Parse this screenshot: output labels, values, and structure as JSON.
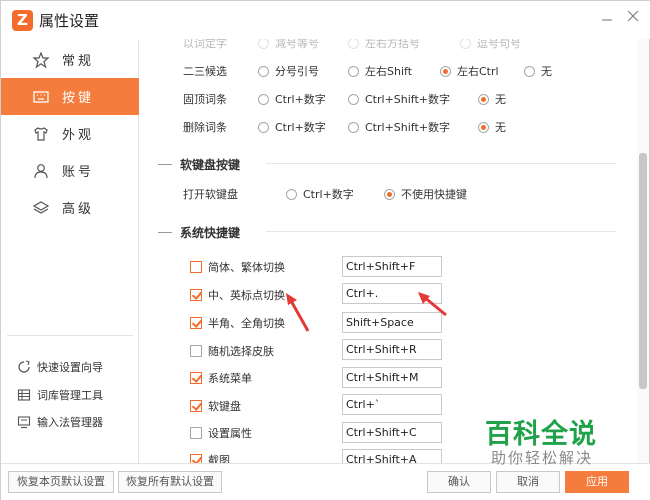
{
  "window": {
    "title": "属性设置",
    "logo_letter": "Z",
    "brand_color": "#f36c2b",
    "accent_color": "#f47c3c"
  },
  "sidebar": {
    "items": [
      {
        "label": "常规",
        "icon": "star-icon",
        "active": false
      },
      {
        "label": "按键",
        "icon": "keyboard-icon",
        "active": true
      },
      {
        "label": "外观",
        "icon": "shirt-icon",
        "active": false
      },
      {
        "label": "账号",
        "icon": "user-icon",
        "active": false
      },
      {
        "label": "高级",
        "icon": "layers-icon",
        "active": false
      }
    ],
    "tools": [
      {
        "label": "快速设置向导",
        "icon": "wizard-icon"
      },
      {
        "label": "词库管理工具",
        "icon": "dictionary-icon"
      },
      {
        "label": "输入法管理器",
        "icon": "manager-icon"
      }
    ]
  },
  "content": {
    "partial_row": {
      "label": "以词定字",
      "options": [
        "减号等号",
        "左右方括号",
        "逗号句号"
      ]
    },
    "candidate_rows": [
      {
        "label": "二三候选",
        "options": [
          "分号引号",
          "左右Shift",
          "左右Ctrl",
          "无"
        ],
        "selected": 2
      },
      {
        "label": "固顶词条",
        "options": [
          "Ctrl+数字",
          "Ctrl+Shift+数字",
          "无"
        ],
        "selected": 2
      },
      {
        "label": "删除词条",
        "options": [
          "Ctrl+数字",
          "Ctrl+Shift+数字",
          "无"
        ],
        "selected": 2
      }
    ],
    "soft_keyboard": {
      "section_title": "软键盘按键",
      "label": "打开软键盘",
      "options": [
        "Ctrl+数字",
        "不使用快捷键"
      ],
      "selected": 1
    },
    "system_shortcuts": {
      "section_title": "系统快捷键",
      "items": [
        {
          "label": "简体、繁体切换",
          "checked": false,
          "key": "Ctrl+Shift+F"
        },
        {
          "label": "中、英标点切换",
          "checked": true,
          "key": "Ctrl+."
        },
        {
          "label": "半角、全角切换",
          "checked": true,
          "key": "Shift+Space"
        },
        {
          "label": "随机选择皮肤",
          "checked": false,
          "key": "Ctrl+Shift+R"
        },
        {
          "label": "系统菜单",
          "checked": true,
          "key": "Ctrl+Shift+M"
        },
        {
          "label": "软键盘",
          "checked": true,
          "key": "Ctrl+`"
        },
        {
          "label": "设置属性",
          "checked": false,
          "key": "Ctrl+Shift+C"
        },
        {
          "label": "截图",
          "checked": true,
          "key": "Ctrl+Shift+A"
        }
      ]
    }
  },
  "footer": {
    "restore_page_label": "恢复本页默认设置",
    "restore_all_label": "恢复所有默认设置",
    "ok_label": "确认",
    "cancel_label": "取消",
    "apply_label": "应用"
  },
  "watermark": {
    "main": "百科全说",
    "sub": "助你轻松解决",
    "color": "#20a24a"
  }
}
